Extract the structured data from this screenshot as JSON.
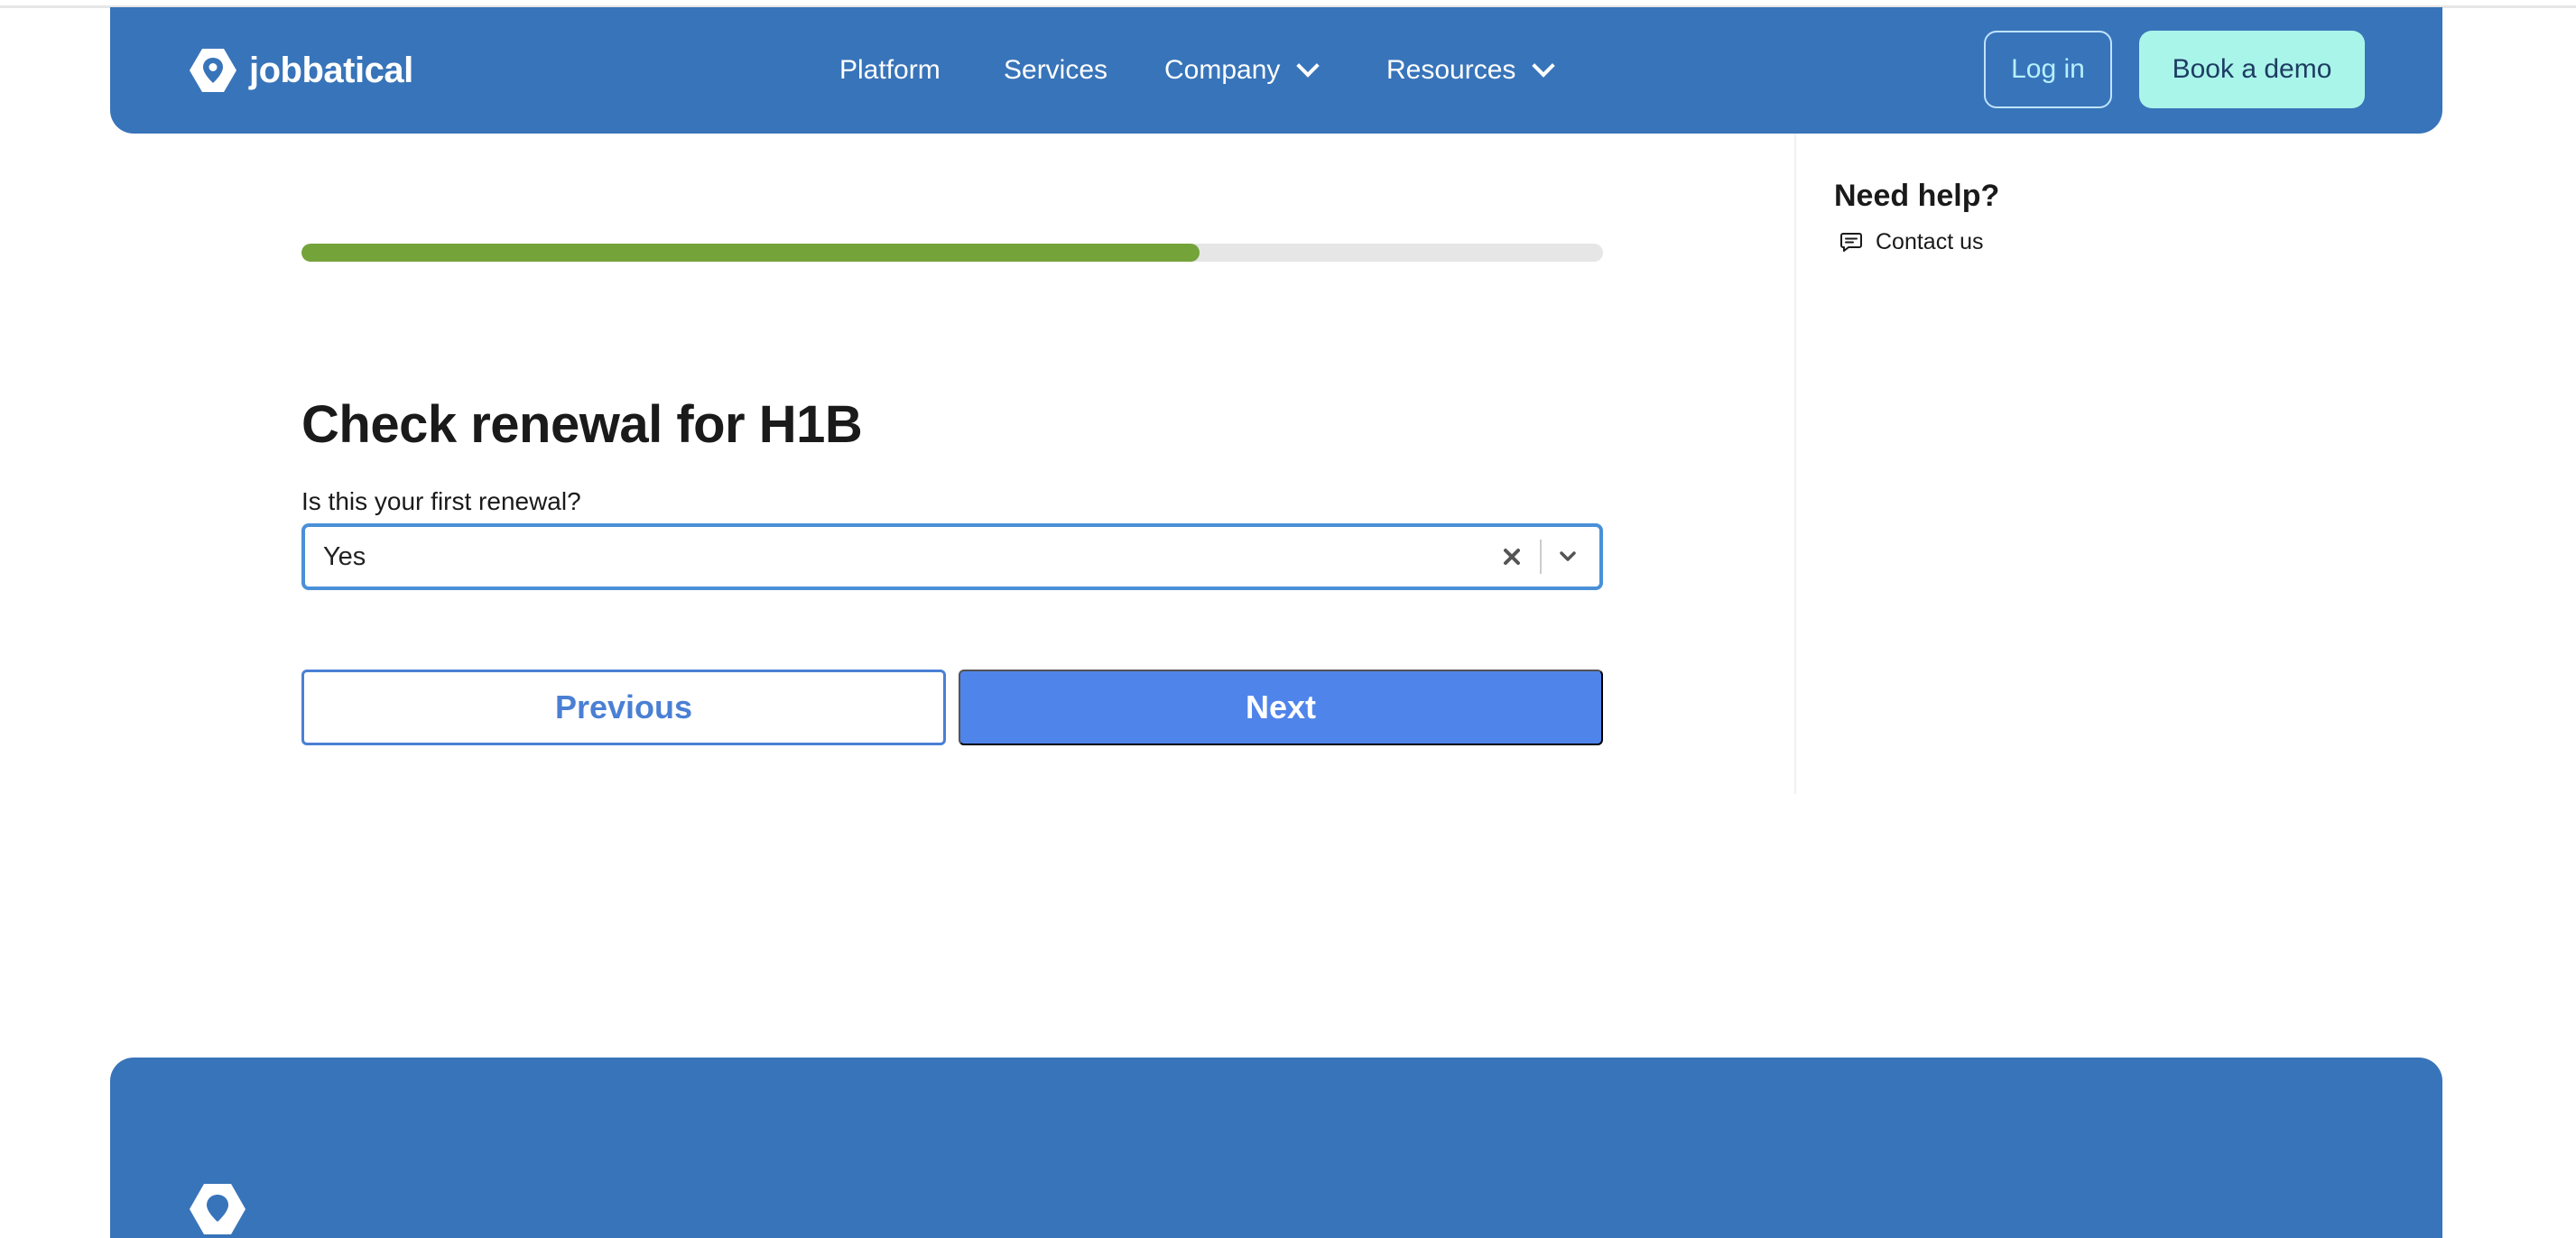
{
  "header": {
    "brand": "jobbatical",
    "nav": [
      {
        "label": "Platform"
      },
      {
        "label": "Services"
      },
      {
        "label": "Company"
      },
      {
        "label": "Resources"
      }
    ],
    "login_label": "Log in",
    "demo_label": "Book a demo"
  },
  "form": {
    "progress_percent": 69,
    "title": "Check renewal for H1B",
    "question_label": "Is this your first renewal?",
    "selected_value": "Yes",
    "previous_label": "Previous",
    "next_label": "Next"
  },
  "help": {
    "title": "Need help?",
    "contact_label": "Contact us"
  },
  "colors": {
    "brand_blue": "#3874b9",
    "accent_mint": "#aaf5ea",
    "progress_green": "#74a33a",
    "primary_button": "#4f84ea"
  },
  "icons": {
    "logo": "jobbatical-logo-icon",
    "nav_dropdown": "chevron-down-icon",
    "clear": "clear-x-icon",
    "select_dropdown": "chevron-down-icon",
    "contact": "chat-bubble-icon"
  }
}
